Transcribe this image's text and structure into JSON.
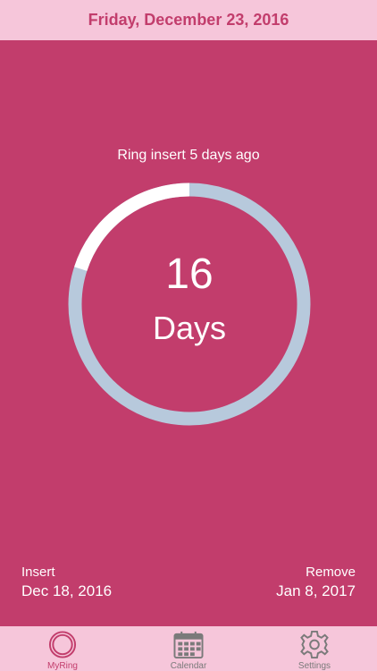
{
  "header": {
    "date": "Friday, December 23, 2016"
  },
  "main": {
    "status_text": "Ring insert 5 days ago",
    "day_count": "16",
    "day_unit": "Days",
    "progress_fraction": 0.2,
    "insert": {
      "label": "Insert",
      "date": "Dec 18, 2016"
    },
    "remove": {
      "label": "Remove",
      "date": "Jan 8, 2017"
    }
  },
  "tabs": [
    {
      "label": "MyRing",
      "icon": "ring-icon",
      "active": true
    },
    {
      "label": "Calendar",
      "icon": "calendar-icon",
      "active": false
    },
    {
      "label": "Settings",
      "icon": "gear-icon",
      "active": false
    }
  ],
  "colors": {
    "accent": "#c23d6c",
    "header_bg": "#f6c6da",
    "ring_track": "#b7c9dc",
    "ring_progress": "#ffffff"
  }
}
